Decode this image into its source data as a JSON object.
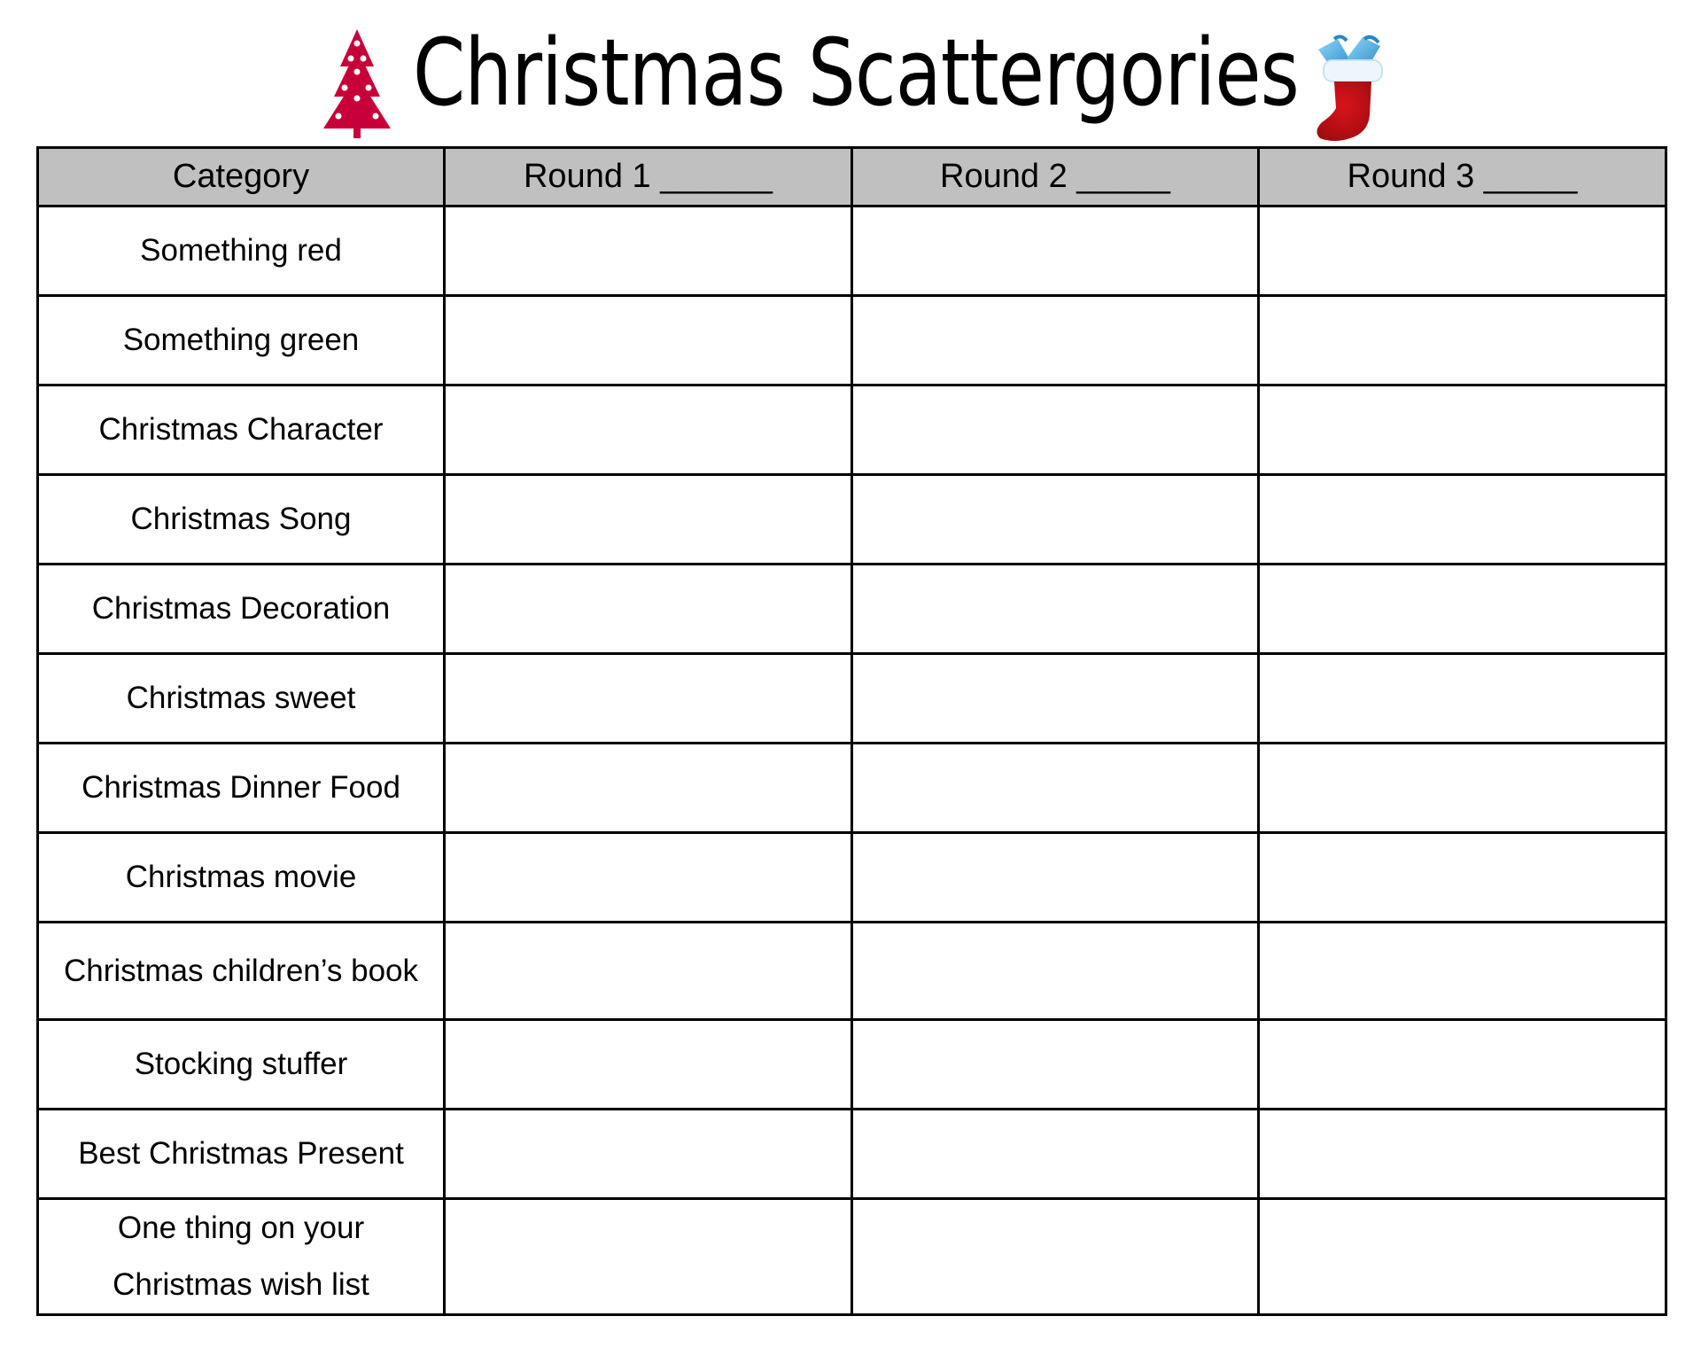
{
  "header": {
    "title": "Christmas Scattergories",
    "left_icon": "christmas-tree-icon",
    "right_icon": "christmas-stocking-icon",
    "colors": {
      "tree": "#c8003a",
      "stocking": "#c00d12",
      "gifts": "#4ab0e0",
      "header_bg": "#c0c0c0"
    }
  },
  "table": {
    "columns": [
      "Category",
      "Round 1 ______",
      "Round 2 _____",
      "Round 3 _____"
    ],
    "rows": [
      {
        "category": "Something red",
        "round1": "",
        "round2": "",
        "round3": ""
      },
      {
        "category": "Something green",
        "round1": "",
        "round2": "",
        "round3": ""
      },
      {
        "category": "Christmas Character",
        "round1": "",
        "round2": "",
        "round3": ""
      },
      {
        "category": "Christmas Song",
        "round1": "",
        "round2": "",
        "round3": ""
      },
      {
        "category": "Christmas Decoration",
        "round1": "",
        "round2": "",
        "round3": ""
      },
      {
        "category": "Christmas sweet",
        "round1": "",
        "round2": "",
        "round3": ""
      },
      {
        "category": "Christmas Dinner Food",
        "round1": "",
        "round2": "",
        "round3": ""
      },
      {
        "category": "Christmas movie",
        "round1": "",
        "round2": "",
        "round3": ""
      },
      {
        "category": "Christmas children’s book",
        "round1": "",
        "round2": "",
        "round3": ""
      },
      {
        "category": "Stocking stuffer",
        "round1": "",
        "round2": "",
        "round3": ""
      },
      {
        "category": "Best Christmas Present",
        "round1": "",
        "round2": "",
        "round3": ""
      },
      {
        "category": "One thing on your",
        "category_line2": "Christmas wish list",
        "round1": "",
        "round2": "",
        "round3": ""
      }
    ]
  }
}
